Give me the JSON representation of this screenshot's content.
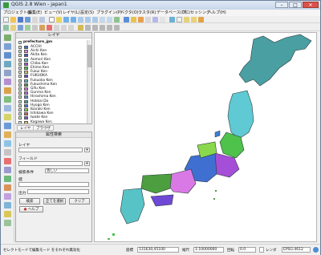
{
  "window": {
    "title": "QGIS 2.8 Wien - japan1",
    "controls": [
      "–",
      "□",
      "✕"
    ]
  },
  "menu": [
    "プロジェクト(J)",
    "編集(E)",
    "ビュー(V)",
    "レイヤ(L)",
    "設定(S)",
    "プラグイン(P)",
    "ベクタ(O)",
    "ラスタ(R)",
    "データベース(D)",
    "プロセッシング",
    "ヘルプ(H)"
  ],
  "layers_panel": {
    "title": "レイヤ",
    "group_name": "prefecture_jpn",
    "items": [
      {
        "label": "ACCHI",
        "color": "#3f6fd1"
      },
      {
        "label": "Aichi Ken",
        "color": "#f08fd9"
      },
      {
        "label": "Akita Ken",
        "color": "#4b54c9"
      },
      {
        "label": "Aomori Ken",
        "color": "#5fcad3"
      },
      {
        "label": "Chiba Ken",
        "color": "#a54ed8"
      },
      {
        "label": "Ehime Ken",
        "color": "#4ec24a"
      },
      {
        "label": "Fukui Ken",
        "color": "#d2d05a"
      },
      {
        "label": "FUKUOKA",
        "color": "#6f48d6"
      },
      {
        "label": "Fukuoka Ken",
        "color": "#58c3c7"
      },
      {
        "label": "Fukushima Ken",
        "color": "#4c9e3e"
      },
      {
        "label": "Gifu Ken",
        "color": "#d979e6"
      },
      {
        "label": "Gunma Ken",
        "color": "#b46fd9"
      },
      {
        "label": "Hiroshima Ken",
        "color": "#5e8ee2"
      },
      {
        "label": "Hokkai Do",
        "color": "#46a3a6"
      },
      {
        "label": "Hyogo Ken",
        "color": "#3e7cd8"
      },
      {
        "label": "Ibaraki Ken",
        "color": "#8ad94c"
      },
      {
        "label": "Ishikawa Ken",
        "color": "#e05e5e"
      },
      {
        "label": "Iwate Ken",
        "color": "#7a57d1"
      },
      {
        "label": "Kagawa Ken",
        "color": "#d9c05a"
      }
    ]
  },
  "tabs": [
    "レイヤ",
    "ブラウザ"
  ],
  "search_panel": {
    "title": "属性検索",
    "layer_label": "レイヤ",
    "field_label": "フィールド",
    "operator_label": "検索条件",
    "operator_value": "等しい",
    "value_label": "値",
    "output_label": "出力",
    "buttons": {
      "search": "検索",
      "select_all": "全てを選択",
      "clear": "クリア",
      "help": "ヘルプ"
    }
  },
  "status": {
    "left_text": "セレクトモードで編集モード をそれぞれ無効化",
    "coord_label": "座標",
    "coord_value": "131630,45100",
    "scale_label": "縮尺",
    "scale_value": "1:10000000",
    "rotation_label": "回転",
    "rotation_value": "0.0",
    "render_label": "レンダ",
    "crs_value": "EPSG:4612"
  },
  "colors": {
    "map_palette": [
      "#3f6fd1",
      "#4ec24a",
      "#a54ed8",
      "#5fcad3",
      "#d979e6",
      "#4c9e3e",
      "#6f48d6",
      "#58c3c7",
      "#3e7cd8",
      "#8ad94c"
    ],
    "hokkaido": "#4a9fa3"
  }
}
